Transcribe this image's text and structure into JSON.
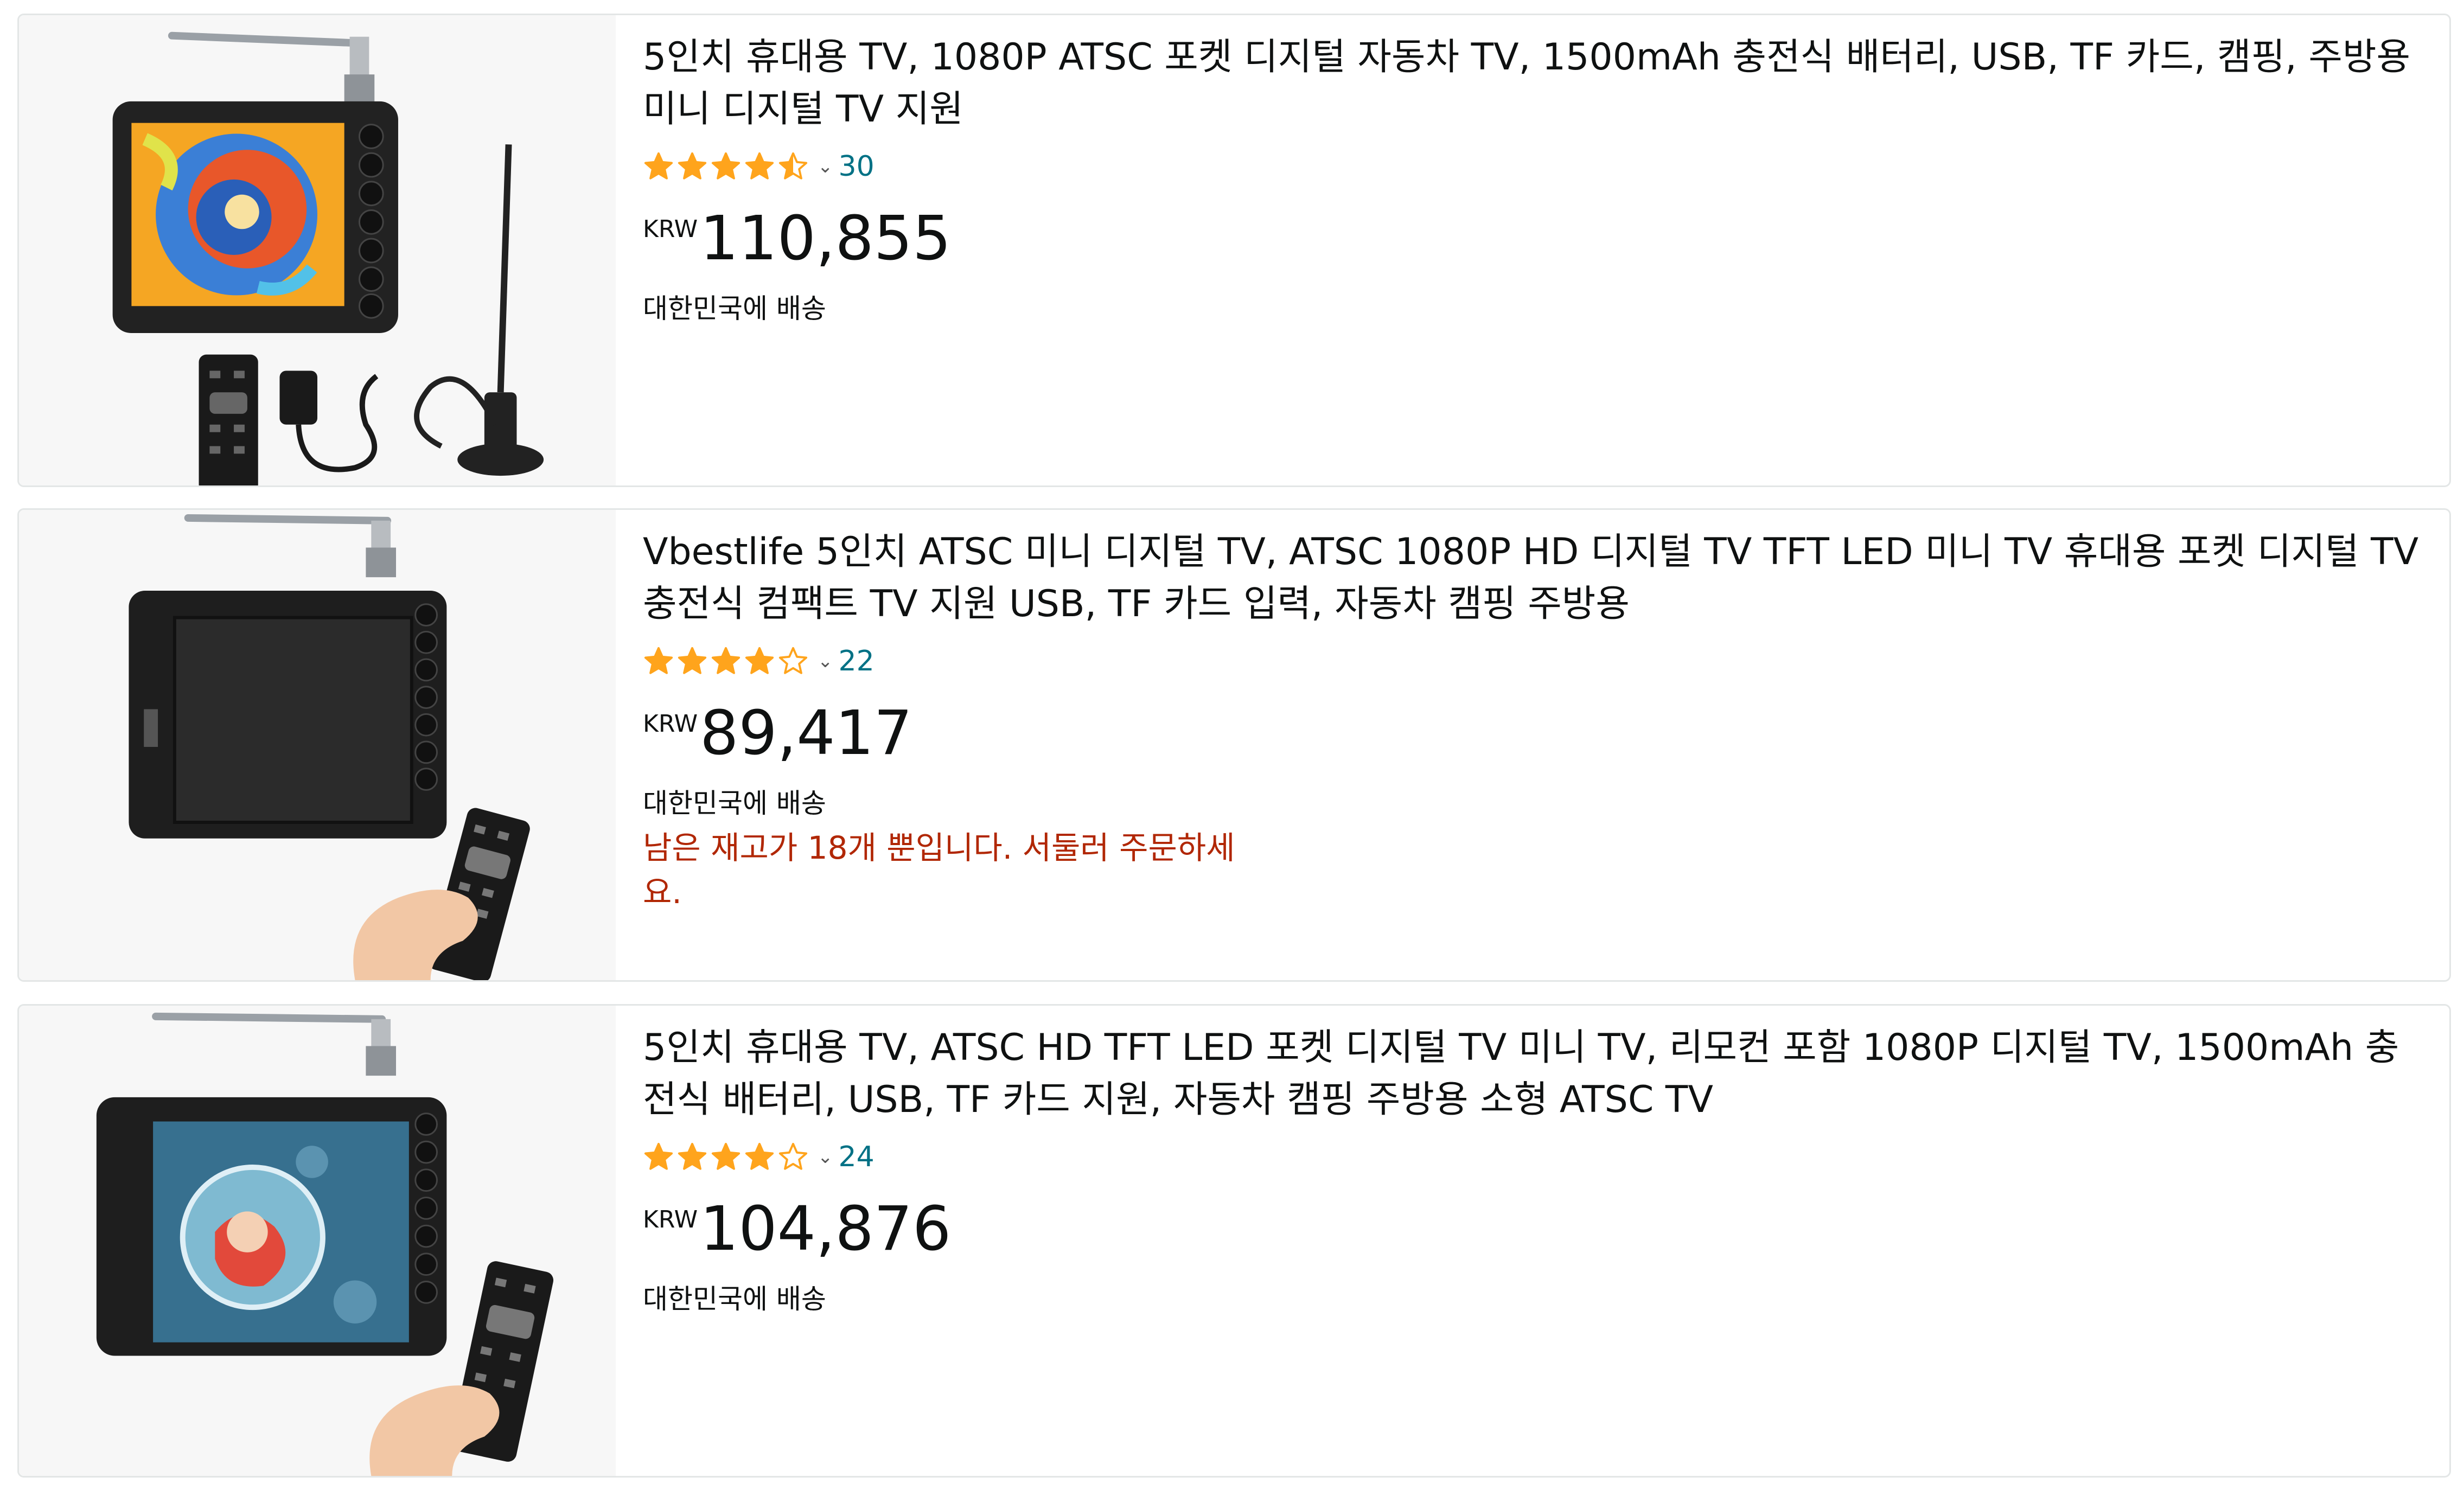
{
  "results": [
    {
      "title": "5인치 휴대용 TV, 1080P ATSC 포켓 디지털 자동차 TV, 1500mAh 충전식 배터리, USB, TF 카드, 캠핑, 주방용 미니 디지털 TV 지원",
      "rating": 4.5,
      "review_count": "30",
      "currency": "KRW",
      "price": "110,855",
      "shipping": "대한민국에 배송",
      "image_icon": "tv-with-remote-adapter-antenna-image"
    },
    {
      "title": "Vbestlife 5인치 ATSC 미니 디지털 TV, ATSC 1080P HD 디지털 TV TFT LED 미니 TV 휴대용 포켓 디지털 TV 충전식 컴팩트 TV 지원 USB, TF 카드 입력, 자동차 캠핑 주방용",
      "rating": 4.0,
      "review_count": "22",
      "currency": "KRW",
      "price": "89,417",
      "shipping": "대한민국에 배송",
      "stock_notice": "남은 재고가 18개 뿐입니다. 서둘러 주문하세요.",
      "image_icon": "tv-black-screen-with-hand-remote-image"
    },
    {
      "title": "5인치 휴대용 TV, ATSC HD TFT LED 포켓 디지털 TV 미니 TV, 리모컨 포함 1080P 디지털 TV, 1500mAh 충전식 배터리, USB, TF 카드 지원, 자동차 캠핑 주방용 소형 ATSC TV",
      "rating": 4.0,
      "review_count": "24",
      "currency": "KRW",
      "price": "104,876",
      "shipping": "대한민국에 배송",
      "image_icon": "tv-anime-screen-with-hand-remote-image"
    }
  ],
  "colors": {
    "star": "#ffa41c",
    "link": "#007185",
    "urgent": "#b12704",
    "text": "#0f1111"
  }
}
